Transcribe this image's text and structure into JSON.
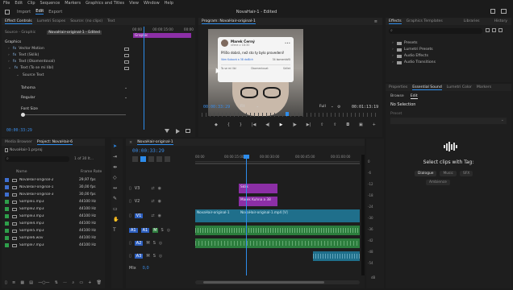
{
  "menu": {
    "items": [
      "File",
      "Edit",
      "Clip",
      "Sequence",
      "Markers",
      "Graphics and Titles",
      "View",
      "Window",
      "Help"
    ]
  },
  "header": {
    "tabs": [
      "Import",
      "Edit",
      "Export"
    ],
    "active_tab": "Edit",
    "title": "NovaHair-1 - Edited"
  },
  "effect_controls": {
    "tabs": [
      "Effect Controls",
      "Lumetri Scopes",
      "Source: (no clips)",
      "Text"
    ],
    "source_label": "Source - Graphic",
    "clip_label": "NovaHair-original-1 - Edited",
    "timecode_head": "00:00",
    "timecode_mid": "00:00:15:00",
    "timecode_end": "00:00",
    "clip_bar": "Graphic",
    "section": "Graphics",
    "items": [
      "Vector Motion",
      "Text (Sklik)",
      "Text (Okomentoval)",
      "Text (To se mi líbí)"
    ],
    "source_text": "Source Text",
    "font": "Tahoma",
    "style": "Regular",
    "font_size": "Font Size",
    "timecode": "00:00:33:29"
  },
  "program": {
    "title": "Program: NovaHair-original-1",
    "post_author": "Marek Černý",
    "post_time": "včera v 18:30",
    "post_text": "Přišlo dobrá, než sto ty bylo provedení!",
    "post_reactions": "Vám Kubová a 38 dalších",
    "post_comments": "34 komentářů",
    "actions": [
      "To se mi líbí",
      "Okomentovat",
      "Sdílet"
    ],
    "timecode": "00:00:33:29",
    "zoom": "Fit",
    "quality": "Full",
    "duration": "00:01:13:19"
  },
  "effects_panel": {
    "tabs": [
      "Effects",
      "Graphics Templates",
      "Libraries",
      "History"
    ],
    "items": [
      "Presets",
      "Lumetri Presets",
      "Audio Effects",
      "Audio Transitions"
    ]
  },
  "essential_sound": {
    "tabs": [
      "Properties",
      "Essential Sound",
      "Lumetri Color",
      "Markers"
    ],
    "subtabs": [
      "Browse",
      "Edit"
    ],
    "status": "No Selection",
    "preset_label": "Preset",
    "prompt": "Select clips with Tag:",
    "tags": [
      "Dialogue",
      "Music",
      "SFX",
      "Ambience"
    ]
  },
  "project": {
    "tabs": [
      "Media Browser",
      "Project: NovaHair-6"
    ],
    "project_file": "NovaHair-1.prproj",
    "count": "1 of 30 It...",
    "columns": [
      "Name",
      "Frame Rate"
    ],
    "rows": [
      {
        "name": "NovaHair-original-2",
        "rate": "29,97 fps",
        "color": "#3e6fd0",
        "type": "video"
      },
      {
        "name": "NovaHair-original-1",
        "rate": "30,00 fps",
        "color": "#3e6fd0",
        "type": "video"
      },
      {
        "name": "NovaHair-original-3",
        "rate": "30,00 fps",
        "color": "#3e6fd0",
        "type": "video"
      },
      {
        "name": "Sample1.mp3",
        "rate": "44100 Hz",
        "color": "#2e9e4a",
        "type": "audio"
      },
      {
        "name": "Sample2.mp3",
        "rate": "44100 Hz",
        "color": "#2e9e4a",
        "type": "audio"
      },
      {
        "name": "Sample3.mp3",
        "rate": "44100 Hz",
        "color": "#2e9e4a",
        "type": "audio"
      },
      {
        "name": "Sample4.mp3",
        "rate": "44100 Hz",
        "color": "#2e9e4a",
        "type": "audio"
      },
      {
        "name": "Sample5.mp3",
        "rate": "44100 Hz",
        "color": "#2e9e4a",
        "type": "audio"
      },
      {
        "name": "Sample6.wav",
        "rate": "44100 Hz",
        "color": "#2e9e4a",
        "type": "audio"
      },
      {
        "name": "Sample7.mp3",
        "rate": "44100 Hz",
        "color": "#2e9e4a",
        "type": "audio"
      }
    ]
  },
  "timeline": {
    "tab": "NovaHair-original-1",
    "timecode": "00:00:33:29",
    "ruler": [
      "00:00",
      "00:00:15:00",
      "00:00:30:00",
      "00:00:45:00",
      "00:01:00:00"
    ],
    "video_tracks": [
      "V3",
      "V2",
      "V1"
    ],
    "audio_tracks": [
      "A1",
      "A2",
      "A3"
    ],
    "mix": "Mix",
    "mix_value": "0,0",
    "clips": {
      "v3": "Sklik",
      "v2": "Marek Kuhna a 38",
      "v1a": "NovaHair-original-1",
      "v1b": "NovaHair-original-1.mp4 [V]"
    },
    "meter_scale": [
      "0",
      "-6",
      "-12",
      "-18",
      "-24",
      "-30",
      "-36",
      "-42",
      "-48",
      "-54"
    ],
    "meter_unit": "dB"
  },
  "colors": {
    "accent": "#2d8ceb",
    "video_clip": "#1f6f8b",
    "graphic_clip": "#8c2fa6",
    "audio_clip": "#2c8a40"
  }
}
